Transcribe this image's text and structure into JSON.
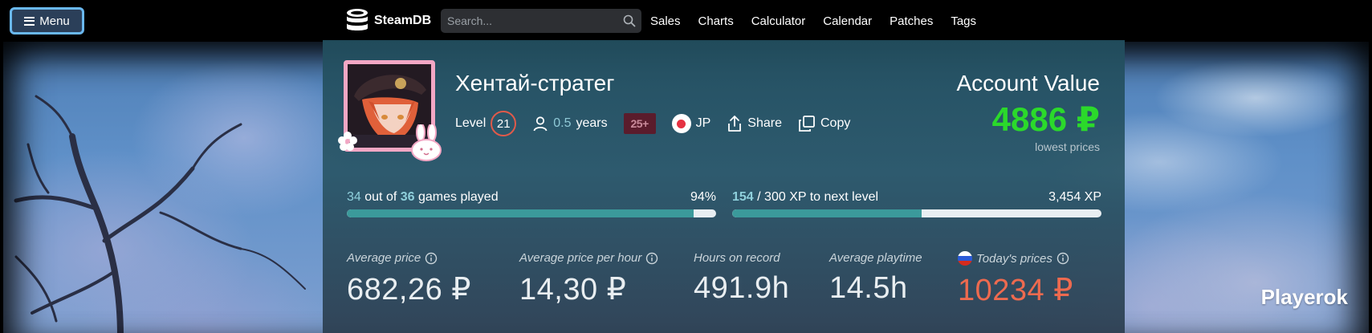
{
  "topbar": {
    "menu_label": "Menu",
    "logo_text": "SteamDB",
    "search_placeholder": "Search...",
    "nav": [
      "Sales",
      "Charts",
      "Calculator",
      "Calendar",
      "Patches",
      "Tags"
    ]
  },
  "profile": {
    "username": "Хентай-стратег",
    "level_label": "Level",
    "level": "21",
    "years_value": "0.5",
    "years_unit": "years",
    "age_badge": "25+",
    "country": "JP",
    "share_label": "Share",
    "copy_label": "Copy"
  },
  "account": {
    "title": "Account Value",
    "value": "4886 ₽",
    "note": "lowest prices"
  },
  "games_progress": {
    "played": "34",
    "out_of": "out of",
    "total": "36",
    "label": "games played",
    "percent_text": "94%",
    "fraction": 0.94
  },
  "xp_progress": {
    "current": "154",
    "rest": "/ 300 XP to next level",
    "total_xp": "3,454 XP",
    "fraction": 0.513
  },
  "stats": {
    "avg_price": {
      "label": "Average price",
      "value": "682,26 ₽"
    },
    "avg_price_hour": {
      "label": "Average price per hour",
      "value": "14,30 ₽"
    },
    "hours": {
      "label": "Hours on record",
      "value": "491.9h"
    },
    "avg_playtime": {
      "label": "Average playtime",
      "value": "14.5h"
    },
    "today_prices": {
      "label": "Today's prices",
      "value": "10234 ₽"
    }
  },
  "watermark": "Playerok",
  "colors": {
    "accent_teal": "#3b9a9b",
    "value_green": "#2bd92b",
    "today_red": "#ee6a4f",
    "menu_border": "#6ab8ef"
  },
  "icons": [
    "hamburger-icon",
    "steamdb-logo-icon",
    "search-icon",
    "user-icon",
    "share-icon",
    "copy-icon",
    "info-icon",
    "flag-jp-icon",
    "flag-ru-icon"
  ]
}
